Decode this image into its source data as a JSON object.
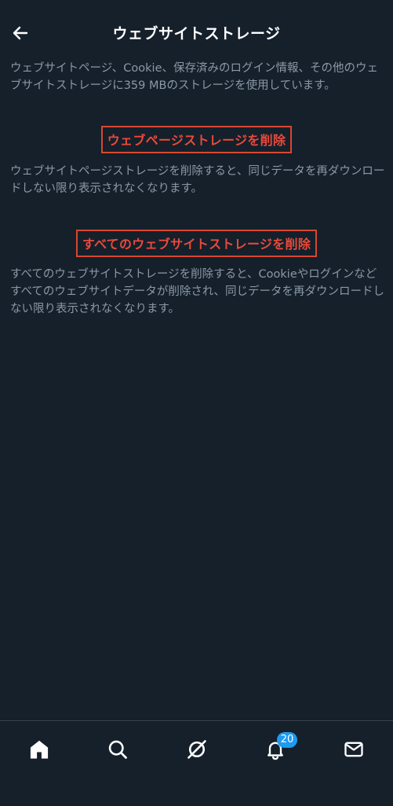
{
  "header": {
    "title": "ウェブサイトストレージ"
  },
  "intro_text": "ウェブサイトページ、Cookie、保存済みのログイン情報、その他のウェブサイトストレージに359 MBのストレージを使用しています。",
  "actions": [
    {
      "label": "ウェブページストレージを削除",
      "description": "ウェブサイトページストレージを削除すると、同じデータを再ダウンロードしない限り表示されなくなります。"
    },
    {
      "label": "すべてのウェブサイトストレージを削除",
      "description": "すべてのウェブサイトストレージを削除すると、Cookieやログインなどすべてのウェブサイトデータが削除され、同じデータを再ダウンロードしない限り表示されなくなります。"
    }
  ],
  "bottom_nav": {
    "items": [
      {
        "icon": "home-icon"
      },
      {
        "icon": "search-icon"
      },
      {
        "icon": "spaces-icon"
      },
      {
        "icon": "bell-icon",
        "badge": "20"
      },
      {
        "icon": "mail-icon"
      }
    ]
  },
  "colors": {
    "background": "#15202b",
    "text_primary": "#ffffff",
    "text_secondary": "#8b98a5",
    "destructive": "#e94a3b",
    "highlight_border": "#d9472f",
    "badge": "#1d9bf0"
  }
}
